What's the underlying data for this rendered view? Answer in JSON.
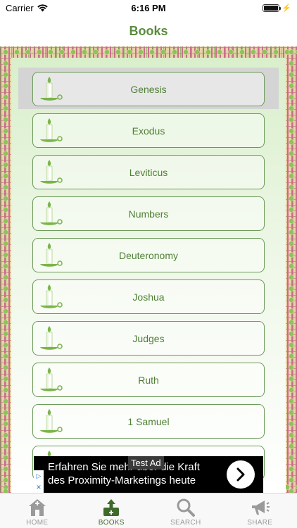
{
  "status_bar": {
    "carrier": "Carrier",
    "time": "6:16 PM",
    "battery_level": 1.0
  },
  "nav": {
    "title": "Books"
  },
  "books": [
    {
      "name": "Genesis",
      "selected": true
    },
    {
      "name": "Exodus"
    },
    {
      "name": "Leviticus"
    },
    {
      "name": "Numbers"
    },
    {
      "name": "Deuteronomy"
    },
    {
      "name": "Joshua"
    },
    {
      "name": "Judges"
    },
    {
      "name": "Ruth"
    },
    {
      "name": "1 Samuel"
    },
    {
      "name": ""
    }
  ],
  "ad": {
    "badge": "Test Ad",
    "line1": "Erfahren Sie mehr über die Kraft",
    "line2": "des Proximity-Marketings heute"
  },
  "tabs": [
    {
      "label": "HOME",
      "icon": "home-icon",
      "active": false
    },
    {
      "label": "BOOKS",
      "icon": "book-upload-icon",
      "active": true
    },
    {
      "label": "SEARCH",
      "icon": "search-icon",
      "active": false
    },
    {
      "label": "SHARE",
      "icon": "megaphone-icon",
      "active": false
    }
  ],
  "colors": {
    "accent": "#5a8b3c",
    "highlight": "#d4d4d4"
  }
}
